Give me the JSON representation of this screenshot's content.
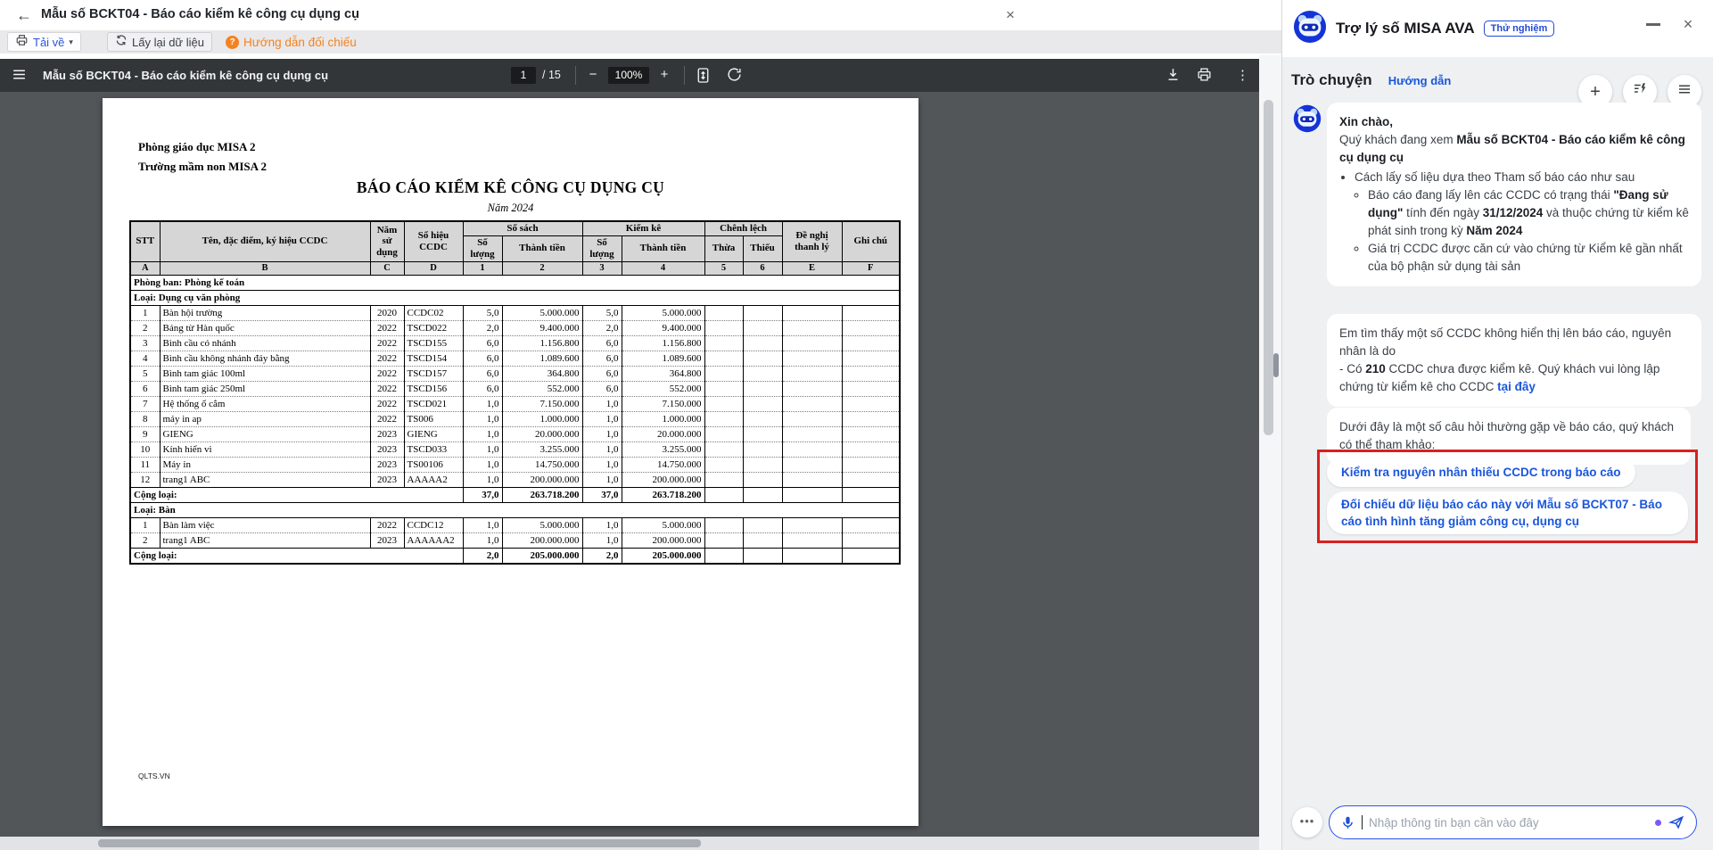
{
  "colors": {
    "accent_blue": "#1a56db",
    "toolbar_orange": "#f5821f",
    "pdf_toolbar_bg": "#323639",
    "doc_bg": "#525659",
    "annotation_red": "#dc1f1f",
    "avatar_blue": "#1434d8",
    "badge_blue": "#2349d8",
    "purple_dot": "#7e57ff"
  },
  "icons": {
    "back_arrow": "←",
    "close": "×",
    "caret_down": "▾",
    "zoom_out": "−",
    "zoom_in": "+",
    "more_vertical": "⋮",
    "more_horizontal": "•••",
    "help": "?"
  },
  "window": {
    "title": "Mẫu số BCKT04 - Báo cáo kiểm kê công cụ dụng cụ",
    "toolbar": {
      "download": "Tải về",
      "reload": "Lấy lại dữ liệu",
      "guide": "Hướng dẫn đối chiếu"
    }
  },
  "pdf": {
    "title": "Mẫu số BCKT04 - Báo cáo kiểm kê công cụ dụng cụ",
    "page": "1",
    "page_total": "/ 15",
    "zoom": "100%"
  },
  "doc": {
    "org1": "Phòng giáo dục MISA 2",
    "org2": "Trường mầm non MISA 2",
    "title": "BÁO CÁO KIỂM KÊ CÔNG CỤ DỤNG CỤ",
    "subtitle": "Năm 2024",
    "footer": "QLTS.VN",
    "table": {
      "h": {
        "stt": "STT",
        "name": "Tên, đặc điểm, ký hiệu CCDC",
        "year": "Năm sử dụng",
        "code": "Số hiệu CCDC",
        "sosach": "Số sách",
        "kiemke": "Kiểm kê",
        "chenhlech": "Chênh lệch",
        "denghi": "Đề nghị thanh lý",
        "ghichu": "Ghi chú",
        "soluong": "Số lượng",
        "thanhtien": "Thành tiền",
        "thua": "Thừa",
        "thieu": "Thiếu"
      },
      "letters": [
        "A",
        "B",
        "C",
        "D",
        "1",
        "2",
        "3",
        "4",
        "5",
        "6",
        "E",
        "F"
      ],
      "rows": [
        {
          "type": "section",
          "label": "Phòng ban:  Phòng kế toán"
        },
        {
          "type": "section",
          "label": "Loại: Dụng cụ văn phòng"
        },
        {
          "type": "data",
          "stt": "1",
          "name": "Bàn hội trường",
          "year": "2020",
          "code": "CCDC02",
          "q1": "5,0",
          "a1": "5.000.000",
          "q2": "5,0",
          "a2": "5.000.000"
        },
        {
          "type": "data",
          "stt": "2",
          "name": "Bảng từ Hàn quốc",
          "year": "2022",
          "code": "TSCD022",
          "q1": "2,0",
          "a1": "9.400.000",
          "q2": "2,0",
          "a2": "9.400.000"
        },
        {
          "type": "data",
          "stt": "3",
          "name": "Bình cầu có nhánh",
          "year": "2022",
          "code": "TSCD155",
          "q1": "6,0",
          "a1": "1.156.800",
          "q2": "6,0",
          "a2": "1.156.800"
        },
        {
          "type": "data",
          "stt": "4",
          "name": "Bình cầu không nhánh đáy bằng",
          "year": "2022",
          "code": "TSCD154",
          "q1": "6,0",
          "a1": "1.089.600",
          "q2": "6,0",
          "a2": "1.089.600"
        },
        {
          "type": "data",
          "stt": "5",
          "name": "Bình tam giác 100ml",
          "year": "2022",
          "code": "TSCD157",
          "q1": "6,0",
          "a1": "364.800",
          "q2": "6,0",
          "a2": "364.800"
        },
        {
          "type": "data",
          "stt": "6",
          "name": "Bình tam giác 250ml",
          "year": "2022",
          "code": "TSCD156",
          "q1": "6,0",
          "a1": "552.000",
          "q2": "6,0",
          "a2": "552.000"
        },
        {
          "type": "data",
          "stt": "7",
          "name": "Hệ thống ổ cắm",
          "year": "2022",
          "code": "TSCD021",
          "q1": "1,0",
          "a1": "7.150.000",
          "q2": "1,0",
          "a2": "7.150.000"
        },
        {
          "type": "data",
          "stt": "8",
          "name": "máy in ap",
          "year": "2022",
          "code": "TS006",
          "q1": "1,0",
          "a1": "1.000.000",
          "q2": "1,0",
          "a2": "1.000.000"
        },
        {
          "type": "data",
          "stt": "9",
          "name": "GIENG",
          "year": "2023",
          "code": "GIENG",
          "q1": "1,0",
          "a1": "20.000.000",
          "q2": "1,0",
          "a2": "20.000.000"
        },
        {
          "type": "data",
          "stt": "10",
          "name": "Kính hiển vi",
          "year": "2023",
          "code": "TSCD033",
          "q1": "1,0",
          "a1": "3.255.000",
          "q2": "1,0",
          "a2": "3.255.000"
        },
        {
          "type": "data",
          "stt": "11",
          "name": "Máy in",
          "year": "2023",
          "code": "TS00106",
          "q1": "1,0",
          "a1": "14.750.000",
          "q2": "1,0",
          "a2": "14.750.000"
        },
        {
          "type": "data",
          "stt": "12",
          "name": "trang1 ABC",
          "year": "2023",
          "code": "AAAAA2",
          "q1": "1,0",
          "a1": "200.000.000",
          "q2": "1,0",
          "a2": "200.000.000"
        },
        {
          "type": "total",
          "label": "Cộng loại:",
          "q1": "37,0",
          "a1": "263.718.200",
          "q2": "37,0",
          "a2": "263.718.200"
        },
        {
          "type": "section",
          "label": "Loại: Bàn"
        },
        {
          "type": "data",
          "stt": "1",
          "name": "Bàn làm việc",
          "year": "2022",
          "code": "CCDC12",
          "q1": "1,0",
          "a1": "5.000.000",
          "q2": "1,0",
          "a2": "5.000.000"
        },
        {
          "type": "data",
          "stt": "2",
          "name": "trang1 ABC",
          "year": "2023",
          "code": "AAAAAA2",
          "q1": "1,0",
          "a1": "200.000.000",
          "q2": "1,0",
          "a2": "200.000.000"
        },
        {
          "type": "total",
          "label": "Cộng loại:",
          "q1": "2,0",
          "a1": "205.000.000",
          "q2": "2,0",
          "a2": "205.000.000"
        }
      ]
    }
  },
  "assistant": {
    "title": "Trợ lý số MISA AVA",
    "badge": "Thử nghiệm",
    "tab": "Trò chuyện",
    "guide_link": "Hướng dẫn",
    "msg1": {
      "greeting": "Xin chào,",
      "intro": [
        {
          "t": "Quý khách đang xem "
        },
        {
          "t": "Mẫu số BCKT04 - Báo cáo kiểm kê công cụ dụng cụ",
          "b": true
        }
      ],
      "bullet1": [
        {
          "t": "Cách lấy số liệu dựa theo Tham số báo cáo như sau"
        }
      ],
      "bullet1a": [
        {
          "t": "Báo cáo đang lấy lên các CCDC có trạng thái "
        },
        {
          "t": "\"Đang sử dụng\"",
          "b": true
        },
        {
          "t": " tính đến ngày "
        },
        {
          "t": "31/12/2024",
          "b": true
        },
        {
          "t": " và thuộc chứng từ kiểm kê phát sinh trong kỳ "
        },
        {
          "t": "Năm 2024",
          "b": true
        }
      ],
      "bullet1b": [
        {
          "t": "Giá trị CCDC được căn cứ vào chứng từ Kiểm kê gần nhất của bộ phận sử dụng tài sản"
        }
      ]
    },
    "msg2": {
      "line1": [
        {
          "t": "Em tìm thấy một số CCDC không hiển thị lên báo cáo, nguyên nhân là do"
        }
      ],
      "line2": [
        {
          "t": "- Có "
        },
        {
          "t": "210",
          "b": true
        },
        {
          "t": " CCDC chưa được kiểm kê. Quý khách vui lòng lập chứng từ kiểm kê cho CCDC "
        },
        {
          "t": "tại đây",
          "b": true,
          "link": true
        }
      ]
    },
    "msg3": "Dưới đây là một số câu hỏi thường gặp về báo cáo, quý khách có thể tham khảo:",
    "chips": [
      "Kiểm tra nguyên nhân thiếu CCDC trong báo cáo",
      "Đối chiếu dữ liệu báo cáo này với Mẫu số BCKT07 - Báo cáo tình hình tăng giảm công cụ, dụng cụ"
    ],
    "input_placeholder": "Nhập thông tin bạn cần vào đây"
  }
}
